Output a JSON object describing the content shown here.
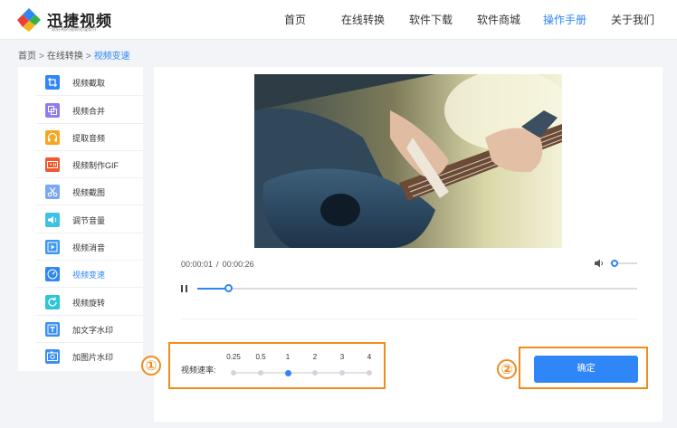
{
  "brand": {
    "title": "迅捷视频",
    "subtitle": "一款好用的视频处理软件",
    "colors": [
      "#e8413b",
      "#f6b21b",
      "#36b24a",
      "#2f86f6"
    ]
  },
  "nav": {
    "items": [
      {
        "label": "首页"
      },
      {
        "label": "在线转换"
      },
      {
        "label": "软件下载"
      },
      {
        "label": "软件商城"
      },
      {
        "label": "操作手册"
      },
      {
        "label": "关于我们"
      }
    ],
    "active_index": 4,
    "accent": "#2f86f6"
  },
  "breadcrumb": {
    "items": [
      "首页",
      "在线转换",
      "视频变速"
    ],
    "separator": ">"
  },
  "sidebar": {
    "items": [
      {
        "label": "视频截取",
        "icon": "crop-icon",
        "color": "#2f86f6"
      },
      {
        "label": "视频合并",
        "icon": "merge-icon",
        "color": "#8e7cf3"
      },
      {
        "label": "提取音频",
        "icon": "headphones-icon",
        "color": "#f5a623"
      },
      {
        "label": "视频制作GIF",
        "icon": "gif-icon",
        "color": "#f0582e"
      },
      {
        "label": "视频截图",
        "icon": "scissors-icon",
        "color": "#7ba7f5"
      },
      {
        "label": "调节音量",
        "icon": "volume-icon",
        "color": "#3ec2e6"
      },
      {
        "label": "视频消音",
        "icon": "play-icon",
        "color": "#3b97f0"
      },
      {
        "label": "视频变速",
        "icon": "speedometer-icon",
        "color": "#2f86f6"
      },
      {
        "label": "视频旋转",
        "icon": "rotate-icon",
        "color": "#2fc4d6"
      },
      {
        "label": "加文字水印",
        "icon": "text-icon",
        "color": "#3a8ff0"
      },
      {
        "label": "加图片水印",
        "icon": "image-icon",
        "color": "#3a8ff0"
      }
    ],
    "active_index": 7
  },
  "player": {
    "current_time": "00:00:01",
    "separator": "/",
    "duration": "00:00:26",
    "progress": 0.07,
    "volume": 0.15
  },
  "speed": {
    "label": "视频速率:",
    "options": [
      "0.25",
      "0.5",
      "1",
      "2",
      "3",
      "4"
    ],
    "selected_index": 2
  },
  "confirm_label": "确定",
  "annotations": {
    "step1": "①",
    "step2": "②",
    "color": "#f08c1b"
  }
}
